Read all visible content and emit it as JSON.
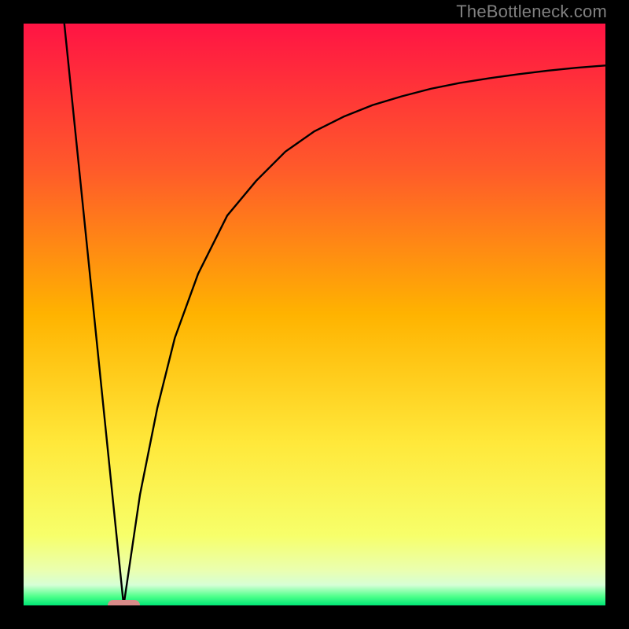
{
  "watermark": "TheBottleneck.com",
  "colors": {
    "frame": "#000000",
    "curve": "#000000",
    "marker": "#d98b89",
    "gradient_stops": [
      {
        "offset": 0.0,
        "color": "#ff1444"
      },
      {
        "offset": 0.25,
        "color": "#ff5a2a"
      },
      {
        "offset": 0.5,
        "color": "#ffb300"
      },
      {
        "offset": 0.72,
        "color": "#ffe83a"
      },
      {
        "offset": 0.88,
        "color": "#f7ff6a"
      },
      {
        "offset": 0.94,
        "color": "#eaffb0"
      },
      {
        "offset": 0.965,
        "color": "#d6ffd6"
      },
      {
        "offset": 0.985,
        "color": "#4cff8a"
      },
      {
        "offset": 1.0,
        "color": "#00e676"
      }
    ]
  },
  "chart_data": {
    "type": "line",
    "title": "",
    "xlabel": "",
    "ylabel": "",
    "xlim": [
      0,
      100
    ],
    "ylim": [
      0,
      100
    ],
    "grid": false,
    "legend": false,
    "gradient": "vertical red→orange→yellow→green",
    "marker": {
      "x": 17.2,
      "y": 0.0,
      "w": 5.5,
      "h": 1.8
    },
    "series": [
      {
        "name": "left-line",
        "kind": "line",
        "x": [
          7.0,
          17.2
        ],
        "y": [
          100.0,
          0.0
        ]
      },
      {
        "name": "right-saturating-curve",
        "kind": "line",
        "x": [
          17.2,
          20,
          23,
          26,
          30,
          35,
          40,
          45,
          50,
          55,
          60,
          65,
          70,
          75,
          80,
          85,
          90,
          95,
          100
        ],
        "y": [
          0.0,
          19,
          34,
          46,
          57,
          67,
          73,
          78,
          81.5,
          84,
          86,
          87.5,
          88.8,
          89.8,
          90.6,
          91.3,
          91.9,
          92.4,
          92.8
        ]
      }
    ]
  }
}
